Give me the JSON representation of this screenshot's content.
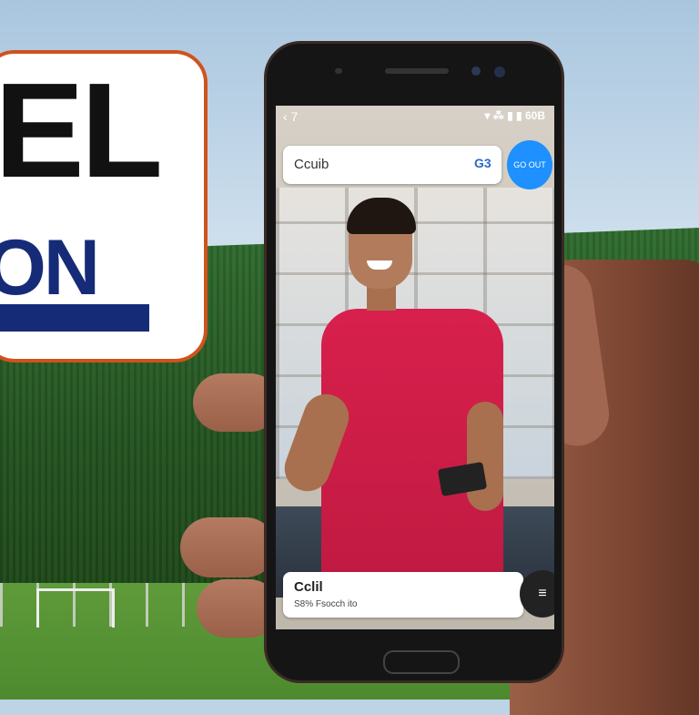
{
  "logo": {
    "top_text": "EL",
    "mid_text": "ON"
  },
  "phone_screen": {
    "status": {
      "back": "‹ 7",
      "icons": "▾ ⁂ ▮ ▮ 60B"
    },
    "search": {
      "query": "Ccuib",
      "badge": "G3",
      "button_label": "GO OUT"
    },
    "bottom_card": {
      "title": "Cclil",
      "subtitle": "S8% Fsocch ito"
    },
    "fab_icon": "filter-icon"
  },
  "colors": {
    "logo_border": "#d0521c",
    "logo_blue": "#162b78",
    "search_button": "#1e90ff",
    "shirt": "#d8204c"
  }
}
